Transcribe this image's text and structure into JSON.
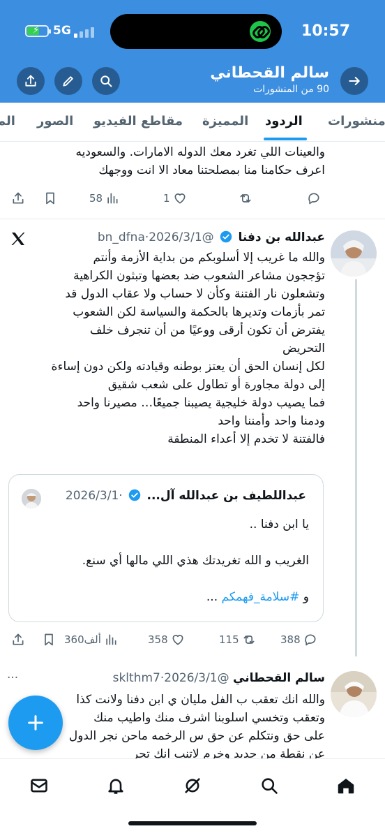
{
  "status_bar": {
    "network": "5G",
    "time": "10:57",
    "battery_level": 0.6
  },
  "header": {
    "profile_name": "سالم القحطاني",
    "posts_count": "90 من المنشورات",
    "icons": [
      "share-icon",
      "edit-icon",
      "search-icon",
      "back-arrow-icon"
    ]
  },
  "tabs": [
    {
      "label": "منشورات",
      "active": false
    },
    {
      "label": "الردود",
      "active": true
    },
    {
      "label": "المميزة",
      "active": false
    },
    {
      "label": "مقاطع الفيديو",
      "active": false
    },
    {
      "label": "الصور",
      "active": false
    },
    {
      "label": "المفضلة",
      "active": false
    }
  ],
  "tweet_top_partial": {
    "lines": [
      "والعينات اللي تغرد معك الدوله الامارات. والسعوديه",
      "اعرف حكامنا منا بمصلحتنا معاد الا انت ووجهك"
    ],
    "replies": "",
    "retweets": "",
    "likes": "1",
    "views": "58"
  },
  "tweet_main": {
    "author_name": "عبدالله بن دفنا",
    "handle": "@bn_dfna",
    "date": "2026/3/1",
    "source_icon": "x-logo-icon",
    "lines": [
      "والله ما غريب إلا أسلوبكم من بداية الأزمة وأنتم",
      "تؤججون مشاعر الشعوب ضد بعضها وتبثون الكراهية",
      "وتشعلون نار الفتنة وكأن لا حساب ولا عقاب الدول قد",
      "تمر بأزمات وتديرها بالحكمة والسياسة لكن الشعوب",
      "يفترض أن تكون أرقى ووعيًا من أن تنجرف خلف",
      "التحريض",
      "لكل إنسان الحق أن يعتز بوطنه وقيادته ولكن دون إساءة",
      "إلى دولة مجاورة أو تطاول على شعب شقيق",
      "فما يصيب دولة خليجية يصيبنا جميعًا… مصيرنا واحد",
      "ودمنا واحد وأمننا واحد",
      "فالفتنة لا تخدم إلا أعداء المنطقة"
    ],
    "quote": {
      "author_name": "عبداللطيف بن عبدالله آل...",
      "date": "2026/3/1",
      "line1": "يا ابن دفنا ..",
      "line2": "الغريب و الله تغريدتك هذي اللي مالها أي سنع.",
      "line3_prefix": "و ",
      "line3_hashtag": "#سلامة_فهمكم",
      "line3_suffix": " ..."
    },
    "replies": "388",
    "retweets": "115",
    "likes": "358",
    "views": "360ألف"
  },
  "tweet_bottom": {
    "author_name": "سالم القحطاني",
    "handle": "@sklthm7",
    "date": "2026/3/1",
    "more": "···",
    "lines": [
      "والله انك تعقب ب الفل مليان ي ابن دفنا ولانت كذا",
      "وتعقب وتخسي  اسلوبنا اشرف منك واطيب منك",
      "على حق ونتكلم عن حق س الرخمه ماحن نجر الدول",
      "عن نقطة من جديد وخرم لاتنب انك تجر"
    ]
  },
  "bottom_nav": [
    "home-icon",
    "search-icon",
    "grok-icon",
    "notifications-icon",
    "messages-icon"
  ],
  "colors": {
    "header_bg": "#3c8ee0",
    "accent": "#1d9bf0",
    "muted": "#536471",
    "text": "#0f1419"
  }
}
